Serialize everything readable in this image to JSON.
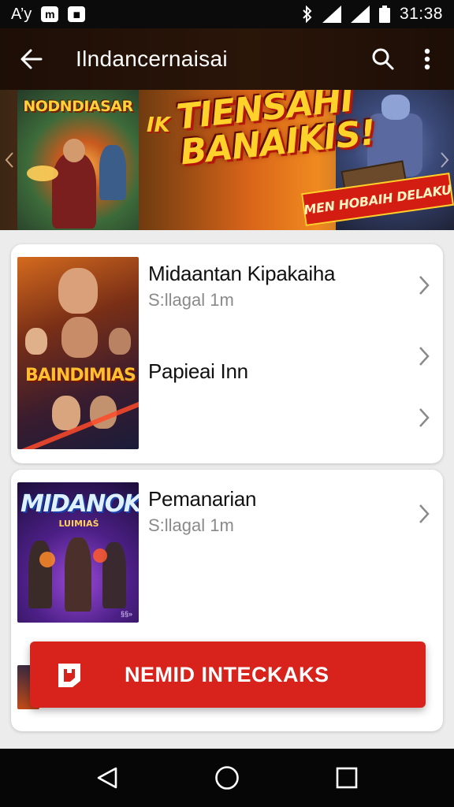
{
  "status_bar": {
    "carrier": "A’y",
    "chip_1": "m",
    "chip_2": "■",
    "time": "31:38"
  },
  "app_bar": {
    "title": "Ilndancernaisai",
    "back_icon": "arrow-left-icon",
    "search_icon": "search-icon",
    "more_icon": "more-vertical-icon"
  },
  "banner": {
    "left_title": "NODNDIASAR",
    "headline": "TIENSAHI BANAIKIS!",
    "headline_prefix": "IK",
    "ribbon": "MEN HOBAIH DELAKU",
    "colors": {
      "headline": "#ffd12b",
      "ribbon": "#d31d12"
    }
  },
  "cards": [
    {
      "poster_logo": "BAINDIMIAS",
      "rows": [
        {
          "title": "Midaantan Kipakaiha",
          "subtitle": "S:llagal 1m"
        },
        {
          "title": "Papieai Inn",
          "subtitle": ""
        },
        {
          "title": "",
          "subtitle": ""
        }
      ]
    },
    {
      "poster_logo": "MIDANOK",
      "poster_sublogo": "LUIMIAŚ",
      "poster_corner": "§§»",
      "rows": [
        {
          "title": "Pemanarian",
          "subtitle": "S:llagal 1m"
        }
      ]
    }
  ],
  "cta": {
    "label": "NEMID INTECKAKS",
    "icon": "app-logo-icon",
    "color": "#d7231c"
  },
  "nav_bar": {
    "back": "nav-back-icon",
    "home": "nav-home-icon",
    "recents": "nav-recents-icon"
  }
}
